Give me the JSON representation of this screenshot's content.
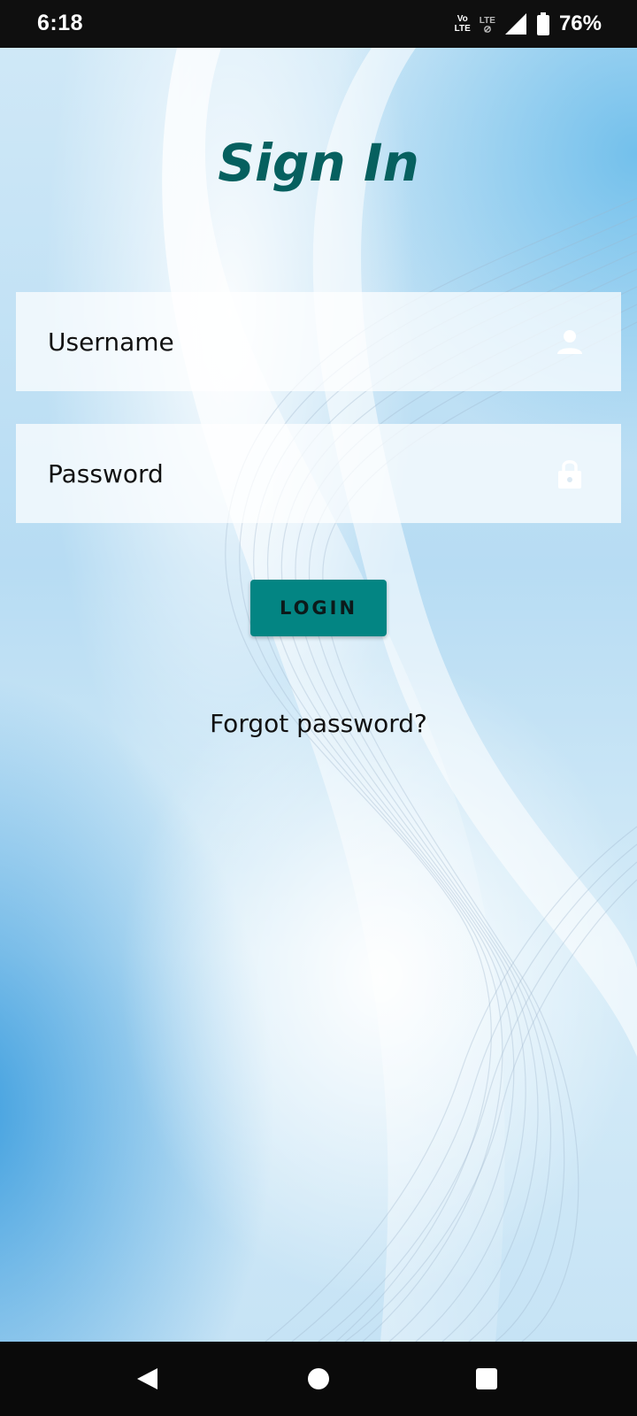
{
  "status_bar": {
    "time": "6:18",
    "volte_top": "Vo",
    "volte_bottom": "LTE",
    "lte_label": "LTE",
    "battery_percent": "76%"
  },
  "login": {
    "title": "Sign In",
    "username_placeholder": "Username",
    "password_placeholder": "Password",
    "login_label": "LOGIN",
    "forgot_label": "Forgot password?"
  },
  "icons": {
    "username": "person-icon",
    "password": "lock-icon",
    "back": "back-triangle-icon",
    "home": "home-circle-icon",
    "recents": "recents-square-icon"
  },
  "colors": {
    "title": "#06605f",
    "button": "#038583",
    "status_bar": "#0f0f0f",
    "nav_bar": "#0a0a0a"
  }
}
